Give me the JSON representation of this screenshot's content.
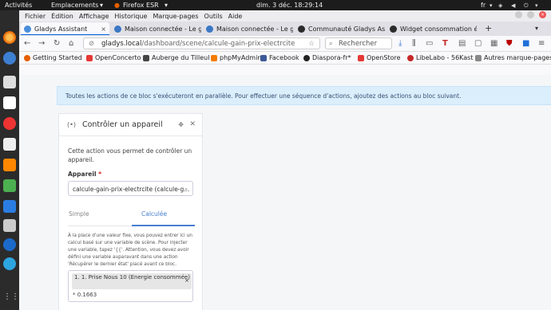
{
  "topbar": {
    "activities": "Activités",
    "places": "Emplacements",
    "app": "Firefox ESR",
    "clock": "dim. 3 déc.  18:29:14",
    "lang": "fr"
  },
  "menubar": [
    "Fichier",
    "Édition",
    "Affichage",
    "Historique",
    "Marque-pages",
    "Outils",
    "Aide"
  ],
  "tabs": [
    {
      "label": "Gladys Assistant",
      "active": true
    },
    {
      "label": "Maison connectée - Le gu",
      "active": false
    },
    {
      "label": "Maison connectée - Le gu",
      "active": false
    },
    {
      "label": "Communauté Gladys Assi",
      "active": false
    },
    {
      "label": "Widget consommation élé",
      "active": false
    }
  ],
  "new_tab": "+",
  "url": {
    "host": "gladys.local",
    "path": "/dashboard/scene/calcule-gain-prix-electrcite"
  },
  "search_placeholder": "Rechercher",
  "bookmarks": [
    "Getting Started",
    "OpenConcerto",
    "Auberge du Tilleul",
    "phpMyAdmin",
    "Facebook",
    "Diaspora-fr*",
    "OpenStore",
    "LibeLabo - 56Kast",
    "Autres marque-pages"
  ],
  "alert": "Toutes les actions de ce bloc s'exécuteront en parallèle. Pour effectuer une séquence d'actions, ajoutez des actions au bloc suivant.",
  "card": {
    "title": "Contrôler un appareil",
    "description": "Cette action vous permet de contrôler un appareil.",
    "device_label": "Appareil",
    "required_mark": "*",
    "device_value": "calcule-gain-prix-electrcite (calcule-g...",
    "tab_simple": "Simple",
    "tab_computed": "Calculée",
    "help": "À la place d'une valeur fixe, vous pouvez entrer ici un calcul basé sur une variable de scène. Pour injecter une variable, tapez '{{'. Attention, vous devez avoir défini une variable auparavant dans une action 'Récupérer le dernier état' placé avant ce bloc.",
    "chip": "1. 1. Prise Nous 10 (Energie consommée)",
    "multiplier": "* 0.1663"
  }
}
